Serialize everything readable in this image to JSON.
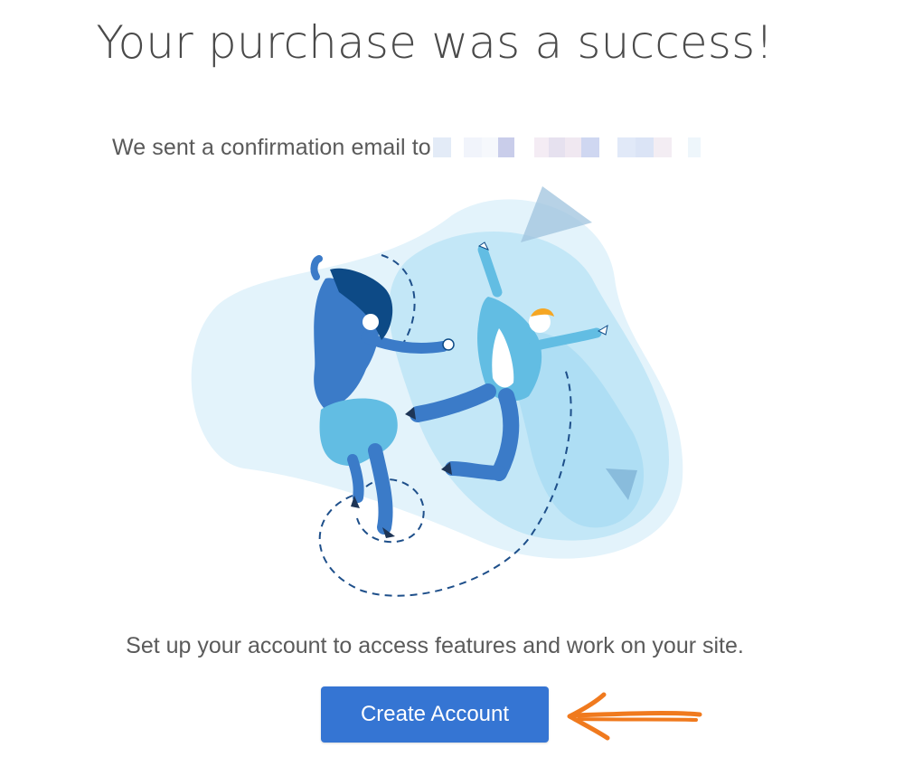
{
  "headline": "Your purchase was a success!",
  "confirmation": {
    "text": "We sent a confirmation email to"
  },
  "setup_message": "Set up your account to access features and work on your site.",
  "create_account_label": "Create Account",
  "colors": {
    "button": "#3575d3",
    "arrow": "#f07a1e",
    "blob_light": "#dff1fb",
    "blob_mid": "#b6e0f5",
    "person_blue": "#3b7bc8",
    "person_light": "#62bde3",
    "hair_dark": "#0d4a86",
    "hair_orange": "#f5a623"
  },
  "icons": [
    "redacted-email",
    "celebration-illustration",
    "hand-drawn-arrow-icon"
  ]
}
